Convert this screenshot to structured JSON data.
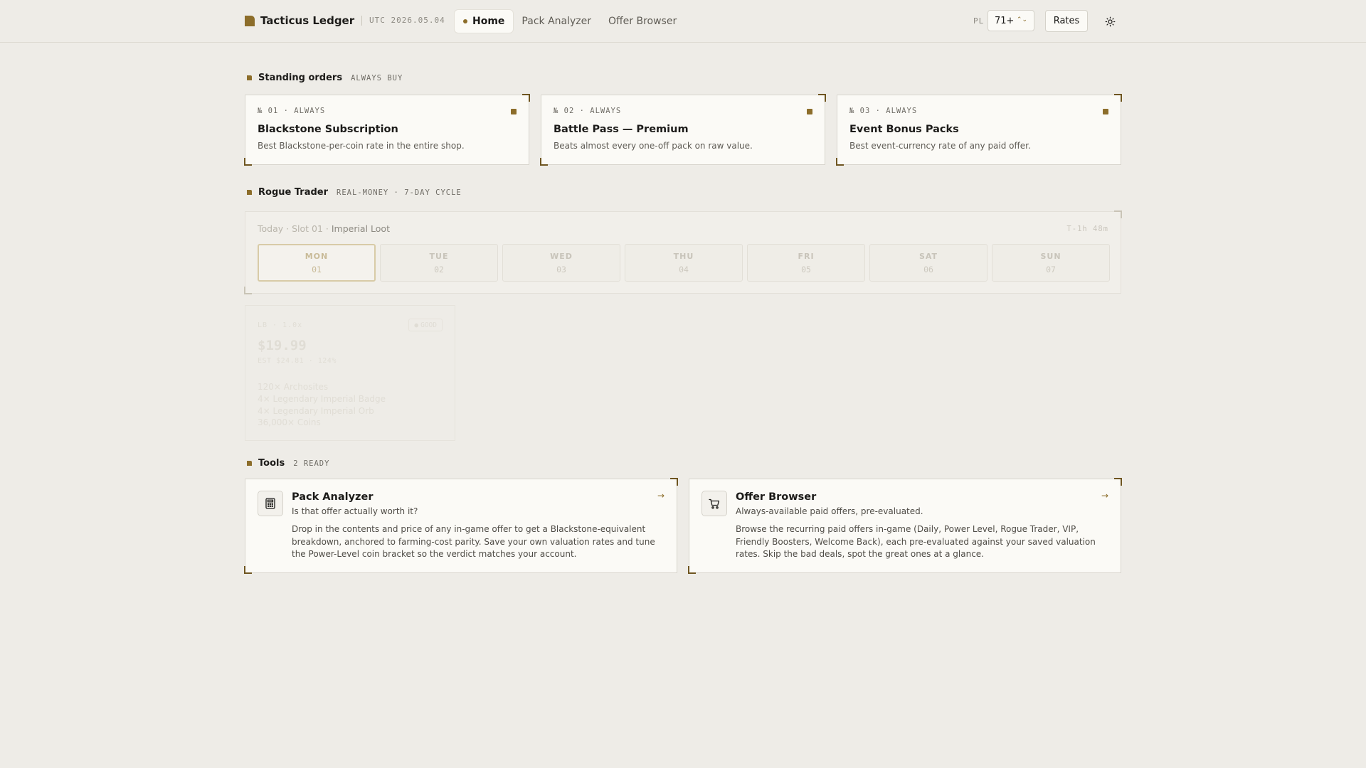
{
  "header": {
    "brand": "Tacticus Ledger",
    "date": "UTC 2026.05.04",
    "nav": [
      {
        "label": "Home",
        "active": true
      },
      {
        "label": "Pack Analyzer",
        "active": false
      },
      {
        "label": "Offer Browser",
        "active": false
      }
    ],
    "pl_label": "PL",
    "pl_value": "71+",
    "rates_label": "Rates"
  },
  "standing_orders": {
    "title": "Standing orders",
    "tag": "ALWAYS BUY",
    "items": [
      {
        "meta": "№ 01 · ALWAYS",
        "title": "Blackstone Subscription",
        "desc": "Best Blackstone-per-coin rate in the entire shop."
      },
      {
        "meta": "№ 02 · ALWAYS",
        "title": "Battle Pass — Premium",
        "desc": "Beats almost every one-off pack on raw value."
      },
      {
        "meta": "№ 03 · ALWAYS",
        "title": "Event Bonus Packs",
        "desc": "Best event-currency rate of any paid offer."
      }
    ]
  },
  "rogue_trader": {
    "title": "Rogue Trader",
    "tag": "REAL-MONEY · 7-DAY CYCLE",
    "today_prefix": "Today · Slot 01 · ",
    "today_name": "Imperial Loot",
    "timer": "T-1h 48m",
    "days": [
      {
        "name": "MON",
        "num": "01",
        "active": true
      },
      {
        "name": "TUE",
        "num": "02",
        "active": false
      },
      {
        "name": "WED",
        "num": "03",
        "active": false
      },
      {
        "name": "THU",
        "num": "04",
        "active": false
      },
      {
        "name": "FRI",
        "num": "05",
        "active": false
      },
      {
        "name": "SAT",
        "num": "06",
        "active": false
      },
      {
        "name": "SUN",
        "num": "07",
        "active": false
      }
    ],
    "offer": {
      "slot": "LB · 1.0x",
      "badge": "GOOD",
      "price": "$19.99",
      "est": "EST $24.81 · 124%",
      "items": [
        "120× Archosites",
        "4× Legendary Imperial Badge",
        "4× Legendary Imperial Orb",
        "36,000× Coins"
      ]
    }
  },
  "tools": {
    "title": "Tools",
    "tag": "2 READY",
    "items": [
      {
        "icon": "calculator-icon",
        "title": "Pack Analyzer",
        "subtitle": "Is that offer actually worth it?",
        "desc": "Drop in the contents and price of any in-game offer to get a Blackstone-equivalent breakdown, anchored to farming-cost parity. Save your own valuation rates and tune the Power-Level coin bracket so the verdict matches your account."
      },
      {
        "icon": "cart-icon",
        "title": "Offer Browser",
        "subtitle": "Always-available paid offers, pre-evaluated.",
        "desc": "Browse the recurring paid offers in-game (Daily, Power Level, Rogue Trader, VIP, Friendly Boosters, Welcome Back), each pre-evaluated against your saved valuation rates. Skip the bad deals, spot the great ones at a glance."
      }
    ]
  },
  "colors": {
    "accent": "#8c6d2a",
    "background": "#eeece7",
    "card": "#fbfaf6"
  }
}
